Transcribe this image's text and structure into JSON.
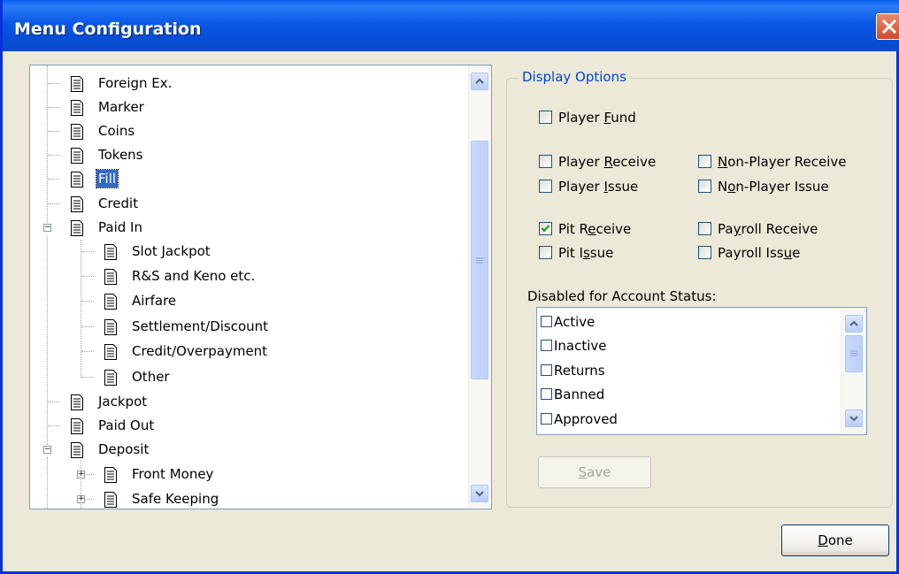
{
  "window": {
    "title": "Menu Configuration"
  },
  "tree": {
    "items": [
      {
        "label": "Foreign Ex."
      },
      {
        "label": "Marker"
      },
      {
        "label": "Coins"
      },
      {
        "label": "Tokens"
      },
      {
        "label": "Fill",
        "selected": true
      },
      {
        "label": "Credit"
      },
      {
        "label": "Paid In",
        "expanded": true
      },
      {
        "label": "Slot Jackpot"
      },
      {
        "label": "R&S and Keno etc."
      },
      {
        "label": "Airfare"
      },
      {
        "label": "Settlement/Discount"
      },
      {
        "label": "Credit/Overpayment"
      },
      {
        "label": "Other"
      },
      {
        "label": "Jackpot"
      },
      {
        "label": "Paid Out"
      },
      {
        "label": "Deposit",
        "expanded": true
      },
      {
        "label": "Front Money",
        "expanded": false
      },
      {
        "label": "Safe Keeping",
        "expanded": false
      }
    ]
  },
  "display_options": {
    "legend": "Display Options",
    "player_fund": {
      "pre": "Player ",
      "key": "F",
      "post": "und",
      "checked": false
    },
    "player_receive": {
      "pre": "Player ",
      "key": "R",
      "post": "eceive",
      "checked": false
    },
    "non_player_receive": {
      "pre": "",
      "key": "N",
      "post": "on-Player Receive",
      "checked": false
    },
    "player_issue": {
      "pre": "Player ",
      "key": "I",
      "post": "ssue",
      "checked": false
    },
    "non_player_issue": {
      "pre": "N",
      "key": "o",
      "post": "n-Player Issue",
      "checked": false
    },
    "pit_receive": {
      "pre": "Pit R",
      "key": "e",
      "post": "ceive",
      "checked": true
    },
    "payroll_receive": {
      "pre": "Pa",
      "key": "y",
      "post": "roll Receive",
      "checked": false
    },
    "pit_issue": {
      "pre": "Pit I",
      "key": "s",
      "post": "sue",
      "checked": false
    },
    "payroll_issue": {
      "pre": "Payroll Iss",
      "key": "u",
      "post": "e",
      "checked": false
    },
    "account_status_label": "Disabled for Account Status:",
    "account_statuses": [
      {
        "label": "Active",
        "checked": false
      },
      {
        "label": "Inactive",
        "checked": false
      },
      {
        "label": "Returns",
        "checked": false
      },
      {
        "label": "Banned",
        "checked": false
      },
      {
        "label": "Approved",
        "checked": false
      }
    ],
    "save": {
      "key": "S",
      "post": "ave",
      "enabled": false
    }
  },
  "done": {
    "key": "D",
    "post": "one"
  },
  "colors": {
    "title_bar": "#0a58e6",
    "selection": "#316ac5",
    "group_legend": "#0046d5",
    "check": "#21a121"
  }
}
